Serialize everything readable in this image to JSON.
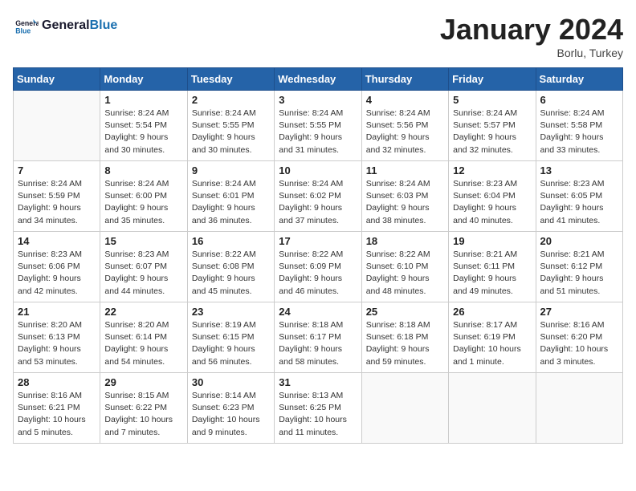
{
  "header": {
    "logo_text_general": "General",
    "logo_text_blue": "Blue",
    "month_title": "January 2024",
    "location": "Borlu, Turkey"
  },
  "days_of_week": [
    "Sunday",
    "Monday",
    "Tuesday",
    "Wednesday",
    "Thursday",
    "Friday",
    "Saturday"
  ],
  "weeks": [
    [
      {
        "day": "",
        "info": ""
      },
      {
        "day": "1",
        "info": "Sunrise: 8:24 AM\nSunset: 5:54 PM\nDaylight: 9 hours\nand 30 minutes."
      },
      {
        "day": "2",
        "info": "Sunrise: 8:24 AM\nSunset: 5:55 PM\nDaylight: 9 hours\nand 30 minutes."
      },
      {
        "day": "3",
        "info": "Sunrise: 8:24 AM\nSunset: 5:55 PM\nDaylight: 9 hours\nand 31 minutes."
      },
      {
        "day": "4",
        "info": "Sunrise: 8:24 AM\nSunset: 5:56 PM\nDaylight: 9 hours\nand 32 minutes."
      },
      {
        "day": "5",
        "info": "Sunrise: 8:24 AM\nSunset: 5:57 PM\nDaylight: 9 hours\nand 32 minutes."
      },
      {
        "day": "6",
        "info": "Sunrise: 8:24 AM\nSunset: 5:58 PM\nDaylight: 9 hours\nand 33 minutes."
      }
    ],
    [
      {
        "day": "7",
        "info": "Sunrise: 8:24 AM\nSunset: 5:59 PM\nDaylight: 9 hours\nand 34 minutes."
      },
      {
        "day": "8",
        "info": "Sunrise: 8:24 AM\nSunset: 6:00 PM\nDaylight: 9 hours\nand 35 minutes."
      },
      {
        "day": "9",
        "info": "Sunrise: 8:24 AM\nSunset: 6:01 PM\nDaylight: 9 hours\nand 36 minutes."
      },
      {
        "day": "10",
        "info": "Sunrise: 8:24 AM\nSunset: 6:02 PM\nDaylight: 9 hours\nand 37 minutes."
      },
      {
        "day": "11",
        "info": "Sunrise: 8:24 AM\nSunset: 6:03 PM\nDaylight: 9 hours\nand 38 minutes."
      },
      {
        "day": "12",
        "info": "Sunrise: 8:23 AM\nSunset: 6:04 PM\nDaylight: 9 hours\nand 40 minutes."
      },
      {
        "day": "13",
        "info": "Sunrise: 8:23 AM\nSunset: 6:05 PM\nDaylight: 9 hours\nand 41 minutes."
      }
    ],
    [
      {
        "day": "14",
        "info": "Sunrise: 8:23 AM\nSunset: 6:06 PM\nDaylight: 9 hours\nand 42 minutes."
      },
      {
        "day": "15",
        "info": "Sunrise: 8:23 AM\nSunset: 6:07 PM\nDaylight: 9 hours\nand 44 minutes."
      },
      {
        "day": "16",
        "info": "Sunrise: 8:22 AM\nSunset: 6:08 PM\nDaylight: 9 hours\nand 45 minutes."
      },
      {
        "day": "17",
        "info": "Sunrise: 8:22 AM\nSunset: 6:09 PM\nDaylight: 9 hours\nand 46 minutes."
      },
      {
        "day": "18",
        "info": "Sunrise: 8:22 AM\nSunset: 6:10 PM\nDaylight: 9 hours\nand 48 minutes."
      },
      {
        "day": "19",
        "info": "Sunrise: 8:21 AM\nSunset: 6:11 PM\nDaylight: 9 hours\nand 49 minutes."
      },
      {
        "day": "20",
        "info": "Sunrise: 8:21 AM\nSunset: 6:12 PM\nDaylight: 9 hours\nand 51 minutes."
      }
    ],
    [
      {
        "day": "21",
        "info": "Sunrise: 8:20 AM\nSunset: 6:13 PM\nDaylight: 9 hours\nand 53 minutes."
      },
      {
        "day": "22",
        "info": "Sunrise: 8:20 AM\nSunset: 6:14 PM\nDaylight: 9 hours\nand 54 minutes."
      },
      {
        "day": "23",
        "info": "Sunrise: 8:19 AM\nSunset: 6:15 PM\nDaylight: 9 hours\nand 56 minutes."
      },
      {
        "day": "24",
        "info": "Sunrise: 8:18 AM\nSunset: 6:17 PM\nDaylight: 9 hours\nand 58 minutes."
      },
      {
        "day": "25",
        "info": "Sunrise: 8:18 AM\nSunset: 6:18 PM\nDaylight: 9 hours\nand 59 minutes."
      },
      {
        "day": "26",
        "info": "Sunrise: 8:17 AM\nSunset: 6:19 PM\nDaylight: 10 hours\nand 1 minute."
      },
      {
        "day": "27",
        "info": "Sunrise: 8:16 AM\nSunset: 6:20 PM\nDaylight: 10 hours\nand 3 minutes."
      }
    ],
    [
      {
        "day": "28",
        "info": "Sunrise: 8:16 AM\nSunset: 6:21 PM\nDaylight: 10 hours\nand 5 minutes."
      },
      {
        "day": "29",
        "info": "Sunrise: 8:15 AM\nSunset: 6:22 PM\nDaylight: 10 hours\nand 7 minutes."
      },
      {
        "day": "30",
        "info": "Sunrise: 8:14 AM\nSunset: 6:23 PM\nDaylight: 10 hours\nand 9 minutes."
      },
      {
        "day": "31",
        "info": "Sunrise: 8:13 AM\nSunset: 6:25 PM\nDaylight: 10 hours\nand 11 minutes."
      },
      {
        "day": "",
        "info": ""
      },
      {
        "day": "",
        "info": ""
      },
      {
        "day": "",
        "info": ""
      }
    ]
  ]
}
